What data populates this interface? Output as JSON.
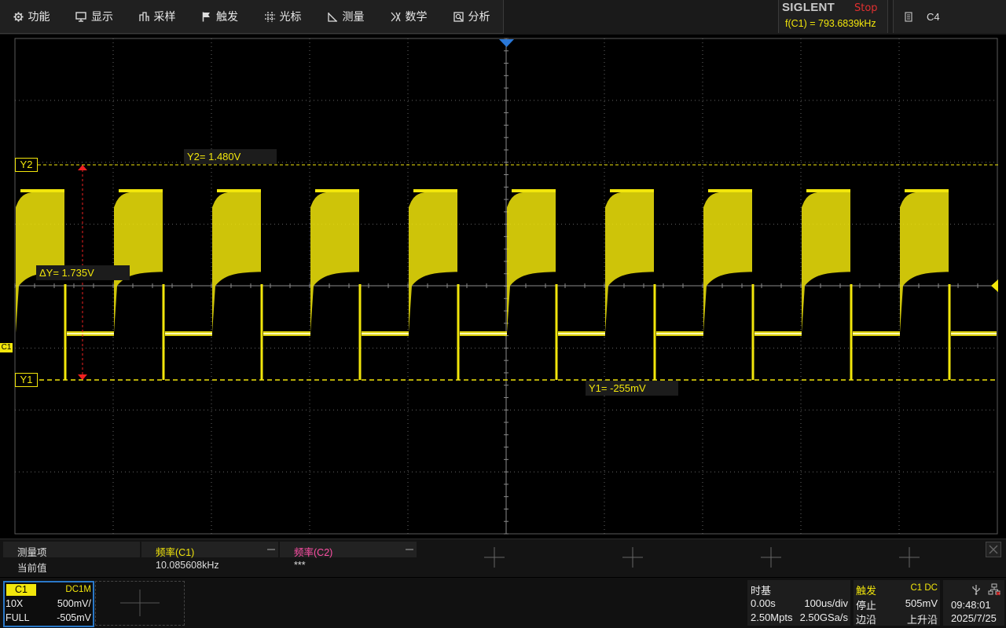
{
  "menu": {
    "items": [
      {
        "label": "功能",
        "icon": "gear-icon"
      },
      {
        "label": "显示",
        "icon": "monitor-icon"
      },
      {
        "label": "采样",
        "icon": "acquire-icon"
      },
      {
        "label": "触发",
        "icon": "flag-icon"
      },
      {
        "label": "光标",
        "icon": "crosshair-icon"
      },
      {
        "label": "测量",
        "icon": "ruler-icon"
      },
      {
        "label": "数学",
        "icon": "math-icon"
      },
      {
        "label": "分析",
        "icon": "analysis-icon"
      }
    ]
  },
  "brand": {
    "name": "SIGLENT",
    "run_state": "Stop",
    "freq_readout": "f(C1) = 793.6839kHz"
  },
  "channel_indicator": {
    "label": "C4",
    "icon": "document-icon"
  },
  "waveform": {
    "color": "#f2e60b",
    "ch_marker": "C1",
    "cursor_y2_tag": "Y2",
    "cursor_y1_tag": "Y1",
    "cursor_y2_value": "Y2= 1.480V",
    "cursor_y1_value": "Y1= -255mV",
    "delta_y": "ΔY= 1.735V"
  },
  "measure": {
    "row_header": "测量项",
    "row_value": "当前值",
    "col1_header": "频率(C1)",
    "col1_value": "10.085608kHz",
    "col2_header": "频率(C2)",
    "col2_value": "***"
  },
  "channel": {
    "name": "C1",
    "coupling": "DC1M",
    "probe": "10X",
    "scale": "500mV/",
    "bandwidth": "FULL",
    "offset": "-505mV"
  },
  "timebase": {
    "title": "时基",
    "delay": "0.00s",
    "scale": "100us/div",
    "memory": "2.50Mpts",
    "sample_rate": "2.50GSa/s"
  },
  "trigger": {
    "title": "触发",
    "source": "C1 DC",
    "mode": "停止",
    "level": "505mV",
    "type": "边沿",
    "slope": "上升沿"
  },
  "clock": {
    "time": "09:48:01",
    "date": "2025/7/25"
  }
}
